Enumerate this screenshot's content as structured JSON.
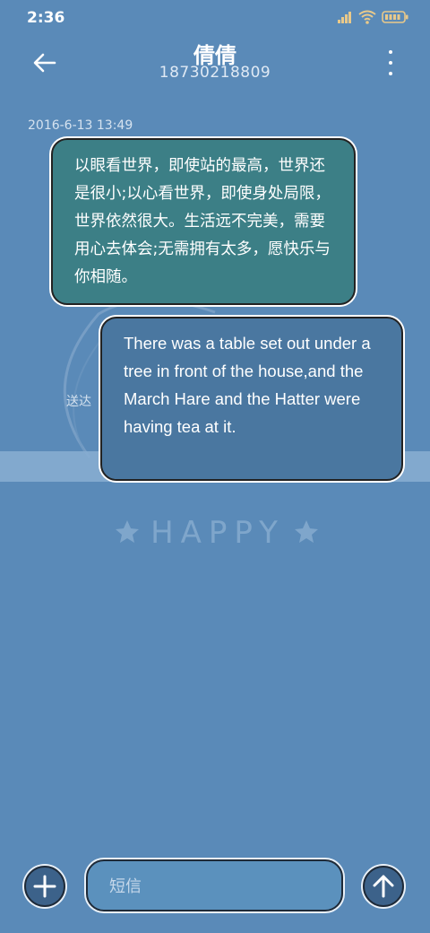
{
  "status_bar": {
    "time": "2:36",
    "icons": [
      "signal-icon",
      "wifi-icon",
      "battery-icon"
    ]
  },
  "header": {
    "contact_name": "倩倩",
    "phone_number": "18730218809",
    "back_icon": "arrow-left-icon",
    "menu_icon": "more-vertical-icon"
  },
  "conversation": {
    "timestamp": "2016-6-13 13:49",
    "messages": [
      {
        "direction": "incoming",
        "text": "以眼看世界，即使站的最高，世界还是很小;以心看世界，即使身处局限，世界依然很大。生活远不完美，需要用心去体会;无需拥有太多，愿快乐与你相随。"
      },
      {
        "direction": "outgoing",
        "text": "There was a table set out under a tree in front of the house,and the March Hare and the Hatter were having tea at it."
      }
    ],
    "delivery_status": "送达"
  },
  "background": {
    "text": "HAPPY"
  },
  "composer": {
    "placeholder": "短信",
    "add_icon": "plus-icon",
    "send_icon": "arrow-up-icon"
  },
  "colors": {
    "background": "#5a8ab8",
    "incoming_bubble": "#3c7f86",
    "outgoing_bubble": "#4a77a0",
    "button": "#3c628a"
  }
}
